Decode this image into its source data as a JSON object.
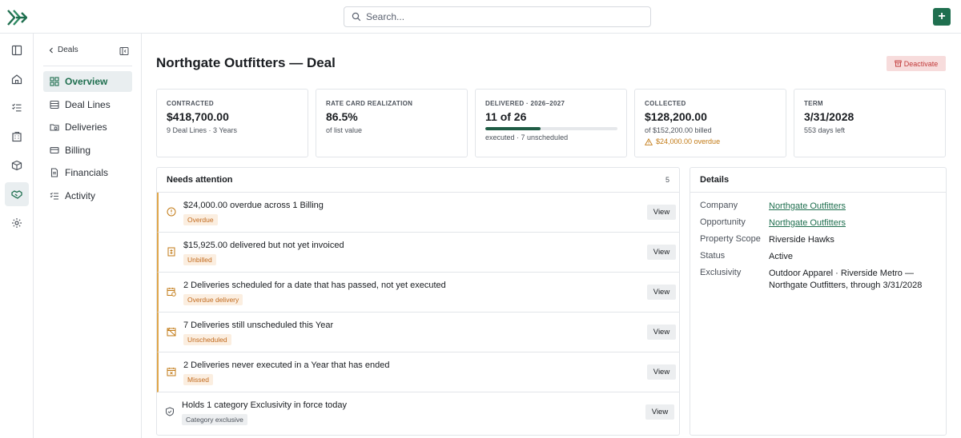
{
  "search": {
    "placeholder": "Search..."
  },
  "colors": {
    "accent": "#1f6f4f",
    "warning": "#c27a15",
    "danger": "#c23a3a"
  },
  "rail": {
    "items": [
      {
        "icon": "panel-icon"
      },
      {
        "icon": "home-icon"
      },
      {
        "icon": "checklist-icon"
      },
      {
        "icon": "building-icon"
      },
      {
        "icon": "package-icon"
      },
      {
        "icon": "handshake-icon",
        "active": true
      },
      {
        "icon": "gear-icon"
      }
    ]
  },
  "subnav": {
    "back_label": "Deals",
    "items": [
      {
        "label": "Overview",
        "icon": "grid-icon",
        "active": true
      },
      {
        "label": "Deal Lines",
        "icon": "list-icon"
      },
      {
        "label": "Deliveries",
        "icon": "folder-icon"
      },
      {
        "label": "Billing",
        "icon": "card-icon"
      },
      {
        "label": "Financials",
        "icon": "document-icon"
      },
      {
        "label": "Activity",
        "icon": "activity-icon"
      }
    ]
  },
  "header": {
    "title": "Northgate Outfitters — Deal",
    "deactivate_label": "Deactivate"
  },
  "stats": [
    {
      "label": "CONTRACTED",
      "value": "$418,700.00",
      "sub": "9 Deal Lines · 3 Years"
    },
    {
      "label": "RATE CARD REALIZATION",
      "value": "86.5%",
      "sub": "of list value"
    },
    {
      "label": "DELIVERED · 2026–2027",
      "value": "11 of 26",
      "progress": 0.42,
      "sub": "executed · 7 unscheduled"
    },
    {
      "label": "COLLECTED",
      "value": "$128,200.00",
      "sub": "of $152,200.00 billed",
      "warning": "$24,000.00 overdue"
    },
    {
      "label": "TERM",
      "value": "3/31/2028",
      "sub": "553 days left"
    }
  ],
  "attention": {
    "title": "Needs attention",
    "count": "5",
    "view_label": "View",
    "rows": [
      {
        "icon": "alert-circle-icon",
        "text": "$24,000.00 overdue across 1 Billing",
        "badge": "Overdue",
        "tone": "orange",
        "flag": true
      },
      {
        "icon": "invoice-icon",
        "text": "$15,925.00 delivered but not yet invoiced",
        "badge": "Unbilled",
        "tone": "orange",
        "flag": true
      },
      {
        "icon": "calendar-clock-icon",
        "text": "2 Deliveries scheduled for a date that has passed, not yet executed",
        "badge": "Overdue delivery",
        "tone": "orange",
        "flag": true
      },
      {
        "icon": "calendar-off-icon",
        "text": "7 Deliveries still unscheduled this Year",
        "badge": "Unscheduled",
        "tone": "orange",
        "flag": true
      },
      {
        "icon": "calendar-x-icon",
        "text": "2 Deliveries never executed in a Year that has ended",
        "badge": "Missed",
        "tone": "orange",
        "flag": true
      },
      {
        "icon": "shield-icon",
        "text": "Holds 1 category Exclusivity in force today",
        "badge": "Category exclusive",
        "tone": "gray",
        "flag": false
      }
    ]
  },
  "details": {
    "title": "Details",
    "rows": [
      {
        "key": "Company",
        "value": "Northgate Outfitters",
        "link": true
      },
      {
        "key": "Opportunity",
        "value": "Northgate Outfitters",
        "link": true
      },
      {
        "key": "Property Scope",
        "value": "Riverside Hawks"
      },
      {
        "key": "Status",
        "value": "Active"
      },
      {
        "key": "Exclusivity",
        "value": "Outdoor Apparel · Riverside Metro — Northgate Outfitters, through 3/31/2028"
      }
    ]
  }
}
